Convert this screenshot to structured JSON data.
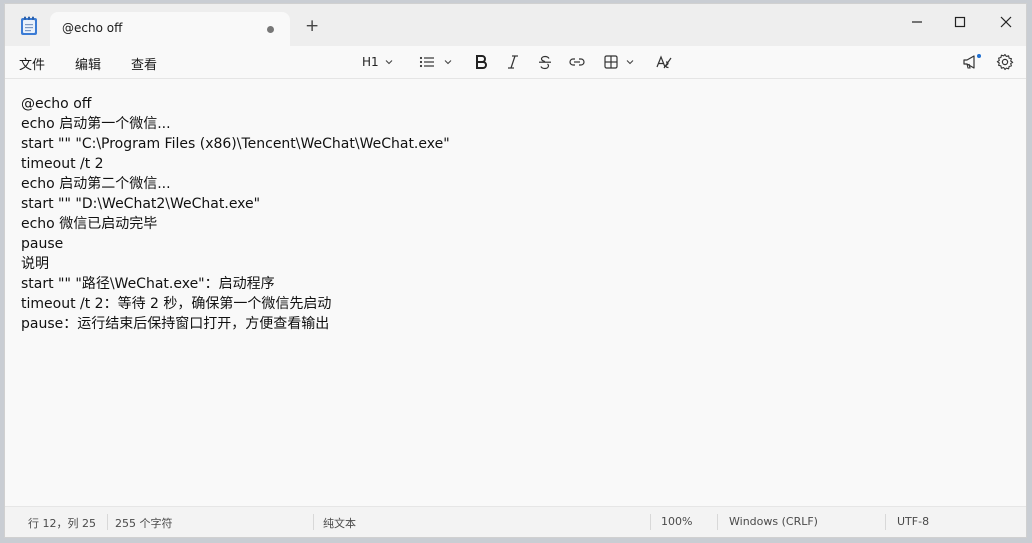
{
  "tab": {
    "title": "@echo off",
    "new_tab": "+"
  },
  "menu": {
    "file": "文件",
    "edit": "编辑",
    "view": "查看"
  },
  "toolbar": {
    "heading": "H1"
  },
  "editor": {
    "lines": [
      "@echo off",
      "echo 启动第一个微信...",
      "start \"\" \"C:\\Program Files (x86)\\Tencent\\WeChat\\WeChat.exe\"",
      "timeout /t 2",
      "echo 启动第二个微信...",
      "start \"\" \"D:\\WeChat2\\WeChat.exe\"",
      "echo 微信已启动完毕",
      "pause",
      "说明",
      "start \"\" \"路径\\WeChat.exe\"：启动程序",
      "timeout /t 2：等待 2 秒，确保第一个微信先启动",
      "pause：运行结束后保持窗口打开，方便查看输出"
    ]
  },
  "status": {
    "position": "行 12，列 25",
    "char_count": "255 个字符",
    "format": "纯文本",
    "zoom": "100%",
    "line_ending": "Windows (CRLF)",
    "encoding": "UTF-8"
  },
  "colors": {
    "accent": "#0067c0",
    "badge": "#1f6fd1"
  }
}
